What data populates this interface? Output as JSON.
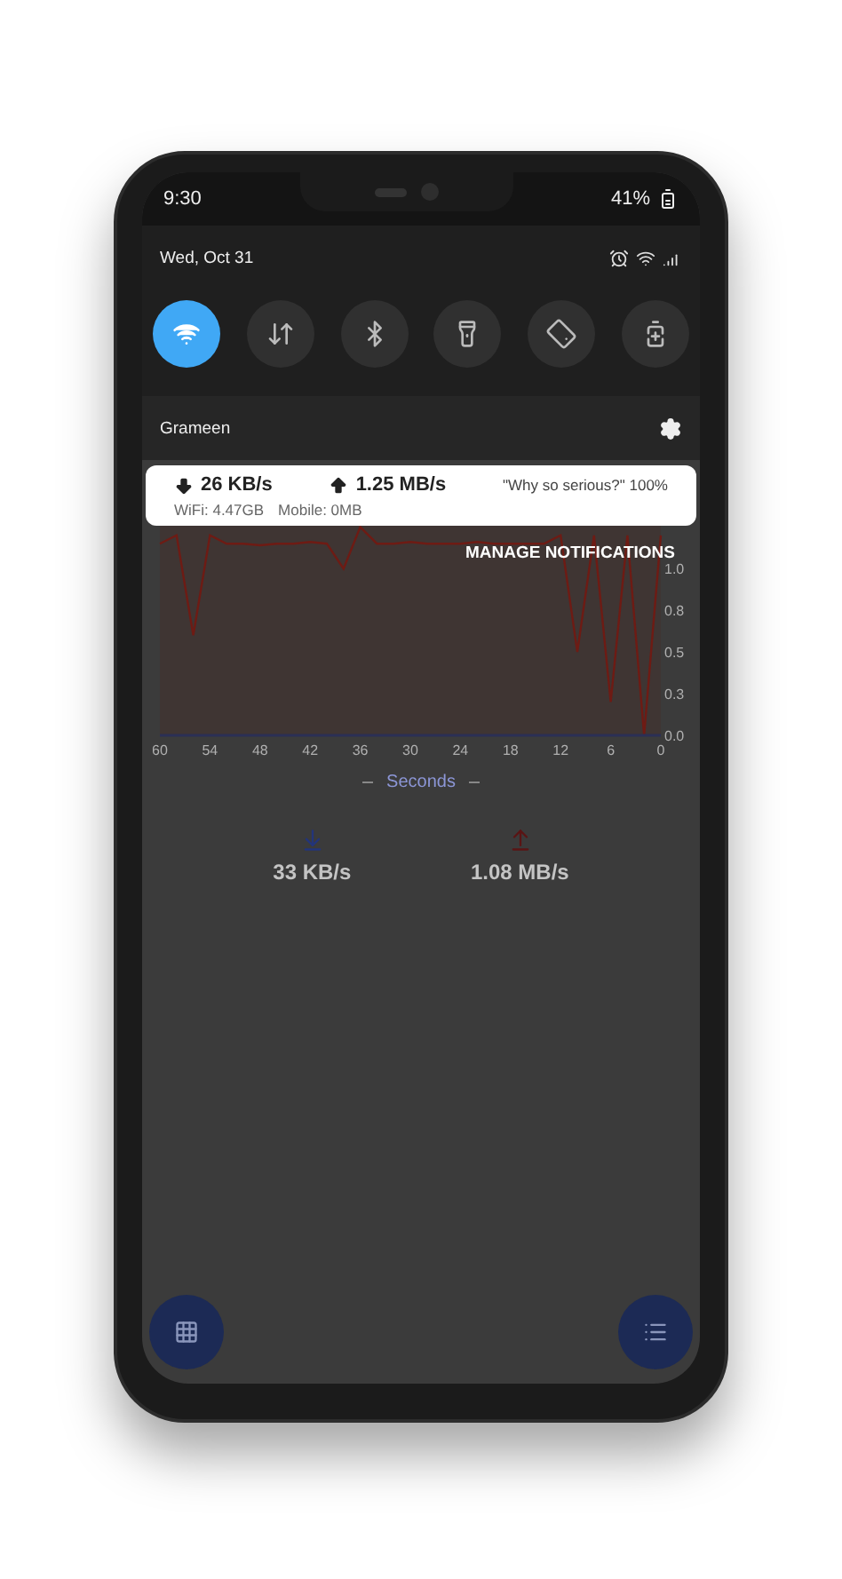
{
  "status_bar": {
    "time": "9:30",
    "battery": "41%"
  },
  "shade": {
    "date": "Wed, Oct 31",
    "toggles": [
      {
        "kind": "wifi",
        "on": true
      },
      {
        "kind": "data",
        "on": false
      },
      {
        "kind": "bluetooth",
        "on": false
      },
      {
        "kind": "flashlight",
        "on": false
      },
      {
        "kind": "rotate",
        "on": false
      },
      {
        "kind": "battery",
        "on": false
      }
    ],
    "network": "Grameen"
  },
  "notification": {
    "download": "26 KB/s",
    "upload": "1.25 MB/s",
    "title": "\"Why so serious?\" 100%",
    "wifi": "WiFi: 4.47GB",
    "mobile": "Mobile: 0MB"
  },
  "manage_notifications": "MANAGE NOTIFICATIONS",
  "app": {
    "chart": {
      "chart_data": {
        "type": "line",
        "xlabel": "Seconds",
        "x": [
          60,
          58,
          56,
          54,
          52,
          50,
          48,
          46,
          44,
          42,
          40,
          38,
          36,
          34,
          32,
          30,
          28,
          26,
          24,
          22,
          20,
          18,
          16,
          14,
          12,
          10,
          8,
          6,
          4,
          2,
          0
        ],
        "xlim": [
          60,
          0
        ],
        "ylim": [
          0,
          1.3
        ],
        "xticks": [
          60,
          54,
          48,
          42,
          36,
          30,
          24,
          18,
          12,
          6,
          0
        ],
        "yticks": [
          {
            "value": 0,
            "label": "0.0"
          },
          {
            "value": 0.25,
            "label": "0.3"
          },
          {
            "value": 0.5,
            "label": "0.5"
          },
          {
            "value": 0.75,
            "label": "0.8"
          },
          {
            "value": 1,
            "label": "1.0"
          }
        ],
        "series": [
          {
            "color": "#6e1b14",
            "values": [
              1.15,
              1.2,
              0.6,
              1.2,
              1.15,
              1.15,
              1.14,
              1.15,
              1.15,
              1.16,
              1.15,
              1.0,
              1.25,
              1.15,
              1.15,
              1.16,
              1.15,
              1.15,
              1.15,
              1.16,
              1.15,
              1.15,
              1.15,
              1.15,
              1.2,
              0.5,
              1.2,
              0.2,
              1.2,
              0.0,
              1.2
            ]
          }
        ]
      }
    },
    "download_speed": "33 KB/s",
    "upload_speed": "1.08 MB/s",
    "fabs": [
      {
        "kind": "grid"
      },
      {
        "kind": "list"
      }
    ]
  }
}
